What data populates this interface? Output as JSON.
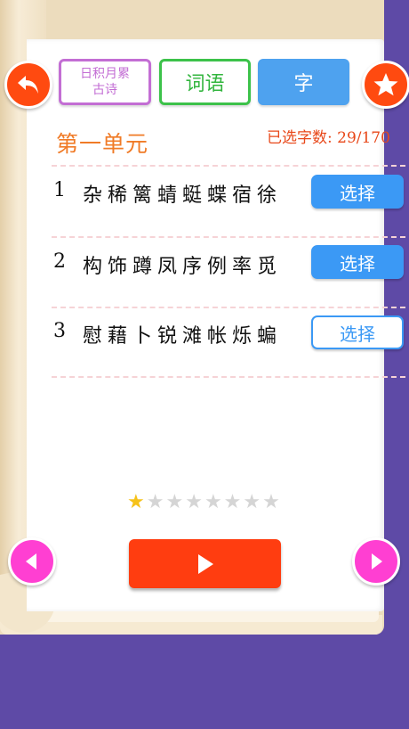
{
  "tabs": {
    "poem_line1": "日积月累",
    "poem_line2": "古诗",
    "words": "词语",
    "char": "字"
  },
  "unit": {
    "title": "第一单元",
    "selected_count": "已选字数: 29/170"
  },
  "rows": [
    {
      "num": "1",
      "chars": "杂稀篱蜻蜓蝶宿徐",
      "button": "选择",
      "style": "filled"
    },
    {
      "num": "2",
      "chars": "构饰蹲凤序例率觅",
      "button": "选择",
      "style": "filled"
    },
    {
      "num": "3",
      "chars": "慰藉卜锐滩帐烁蝙",
      "button": "选择",
      "style": "outline"
    }
  ],
  "rating": {
    "filled": 1,
    "total": 8
  },
  "icons": {
    "back": "back-arrow-icon",
    "star": "star-icon",
    "prev": "triangle-left-icon",
    "next": "triangle-right-icon",
    "play": "play-icon"
  },
  "colors": {
    "background": "#5e4aa6",
    "accent_orange": "#ff4a10",
    "tab_poem": "#c36ed4",
    "tab_words": "#3cc24a",
    "tab_char": "#4ea2ef",
    "select_blue": "#3b99f5",
    "nav_pink": "#ff3fd2"
  }
}
